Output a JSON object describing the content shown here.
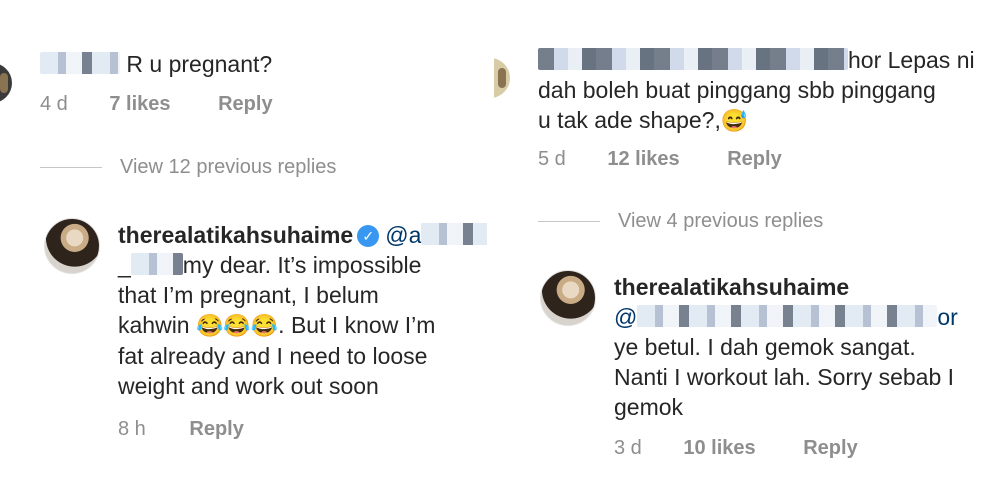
{
  "left": {
    "top_comment": {
      "username_partial": "zura_ok",
      "text": "R u pregnant?",
      "time": "4 d",
      "likes": "7 likes",
      "reply": "Reply"
    },
    "view_replies": "View 12 previous replies",
    "reply": {
      "username": "therealatikahsuhaime",
      "mention": "@a",
      "mention_tail": "_",
      "text_line1": "my dear. It’s impossible",
      "text_line2": "that I’m pregnant, I belum",
      "text_line3_prefix": "kahwin ",
      "emoji": "😂😂😂",
      "text_line3_suffix": ". But I know I’m",
      "text_line4": "fat already and I need to loose",
      "text_line5": "weight and work out soon",
      "time": "8 h",
      "reply_label": "Reply"
    }
  },
  "right": {
    "top_comment": {
      "text_line1_tail": "hor Lepas ni",
      "text_line2": "dah boleh buat pinggang sbb pinggang",
      "text_line3": "u tak ade shape?,",
      "emoji": "😅",
      "time": "5 d",
      "likes": "12 likes",
      "reply": "Reply"
    },
    "view_replies": "View 4 previous replies",
    "reply": {
      "username": "therealatikahsuhaime",
      "mention": "@",
      "mention_tail": "or",
      "text_line2": "ye betul. I dah gemok sangat.",
      "text_line3": "Nanti I workout lah. Sorry sebab I",
      "text_line4": "gemok",
      "time": "3 d",
      "likes": "10 likes",
      "reply_label": "Reply"
    }
  },
  "colors": {
    "text": "#262626",
    "meta": "#8e8e8e",
    "verified": "#3897f0",
    "mention": "#00376b"
  }
}
